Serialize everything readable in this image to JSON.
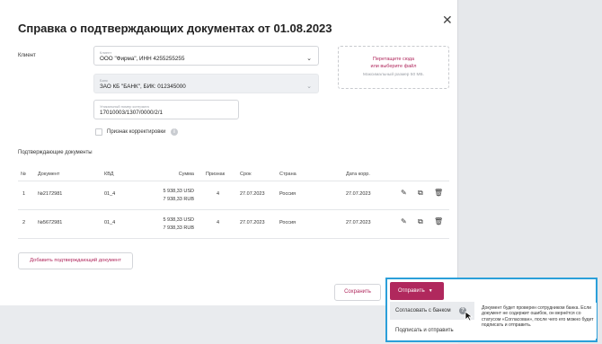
{
  "modal": {
    "title": "Справка о подтверждающих документах от 01.08.2023",
    "close_glyph": "✕"
  },
  "form": {
    "client_label": "Клиент",
    "client_field": {
      "label": "Клиент",
      "value": "ООО \"Фирма\", ИНН 4255255255"
    },
    "bank_field": {
      "label": "Банк",
      "value": "ЗАО КБ \"БАНК\", БИК: 012345000"
    },
    "contract_field": {
      "label": "Уникальный номер контракта",
      "value": "17010003/1307/0000/2/1"
    },
    "correction_label": "Признак корректировки",
    "dropzone": {
      "line1": "Перетащите сюда",
      "line2": "или выберите файл",
      "hint": "Максимальный размер 50 МБ."
    }
  },
  "documents": {
    "title": "Подтверждающие документы",
    "columns": [
      "№",
      "Документ",
      "КВД",
      "Сумма",
      "Признак",
      "Срок",
      "Страна",
      "Дата корр."
    ],
    "rows": [
      {
        "num": "1",
        "doc": "№2172981",
        "kvd": "01_4",
        "sum1": "5 938,33 USD",
        "sum2": "7 938,33 RUB",
        "flag": "4",
        "term": "27.07.2023",
        "country": "Россия",
        "date": "27.07.2023"
      },
      {
        "num": "2",
        "doc": "№5672981",
        "kvd": "01_4",
        "sum1": "5 938,33 USD",
        "sum2": "7 938,33 RUB",
        "flag": "4",
        "term": "27.07.2023",
        "country": "Россия",
        "date": "27.07.2023"
      }
    ],
    "add_button": "Добавить подтверждающий документ"
  },
  "footer": {
    "save": "Сохранить",
    "send": "Отправить",
    "send_arrow": "▼",
    "menu": [
      "Согласовать с банком",
      "Подписать и отправить"
    ],
    "tooltip": "Документ будет проверен сотрудником банка. Если документ не содержит ошибок, он вернётся со статусом «Согласован», после чего его можно будет подписать и отправить."
  },
  "colors": {
    "accent": "#b0285d",
    "highlight": "#2b9fd9"
  }
}
